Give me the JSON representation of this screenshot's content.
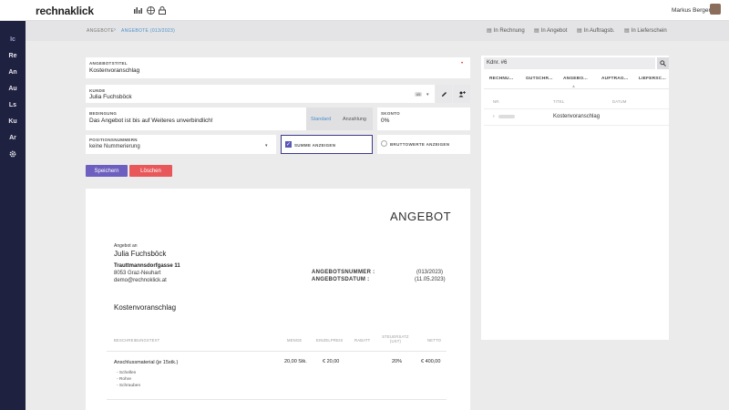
{
  "app": {
    "logo": "rechnaklick",
    "user": "Markus Berger"
  },
  "topbar_icons": [
    "chart-icon",
    "globe-icon",
    "lock-icon"
  ],
  "sidebar": {
    "items": [
      "Ic",
      "Re",
      "An",
      "Au",
      "Ls",
      "Ku",
      "Ar"
    ]
  },
  "breadcrumb": {
    "parent": "ANGEBOTE",
    "current": "ANGEBOTE (013/2023)"
  },
  "subactions": [
    "In Rechnung",
    "In Angebot",
    "In Auftragsb.",
    "In Lieferschein"
  ],
  "form": {
    "title_label": "ANGEBOTSTITEL",
    "title_value": "Kostenvoranschlag",
    "customer_label": "KUNDE",
    "customer_value": "Julia Fuchsböck",
    "customer_badge": "#5",
    "condition_label": "BEDINGUNG",
    "condition_value": "Das Angebot ist bis auf Weiteres unverbindlich!",
    "standard_label": "Standard",
    "anzahlung_label": "Anzahlung",
    "skonto_label": "SKONTO",
    "skonto_value": "0%",
    "positions_label": "POSITIONSNUMMERN",
    "positions_value": "keine Nummerierung",
    "sum_label": "SUMME ANZEIGEN",
    "brutto_label": "BRUTTOWERTE ANZEIGEN",
    "save": "Speichern",
    "delete": "Löschen"
  },
  "right": {
    "search_value": "Kdnr. #6",
    "tabs": [
      "RECHNU...",
      "GUTSCHR...",
      "ANGEBO...",
      "AUFTRAG...",
      "LIEFERSC..."
    ],
    "headers": [
      "NR.",
      "TITEL",
      "DATUM"
    ],
    "row": {
      "nr": "",
      "title": "Kostenvoranschlag",
      "date": ""
    }
  },
  "doc": {
    "heading": "ANGEBOT",
    "to_label": "Angebot an",
    "name": "Julia Fuchsböck",
    "street": "Trauttmannsdorfgasse 11",
    "city": "8053 Graz-Neuhart",
    "email": "demo@rechnoklick.at",
    "nr_label": "ANGEBOTSNUMMER :",
    "date_label": "ANGEBOTSDATUM :",
    "nr_value": "(013/2023)",
    "date_value": "(11.05.2023)",
    "subject": "Kostenvoranschlag",
    "table_headers": [
      "BESCHREIBUNGSTEXT",
      "MENGE",
      "EINZELPREIS",
      "RABATT",
      "STEUERSATZ (UST)",
      "NETTO"
    ],
    "row1": {
      "desc": "Anschlussmaterial (je 15stk.)",
      "sub": [
        "- Schellen",
        "- Rohre",
        "- Schrauben"
      ],
      "qty": "20,00 Stk.",
      "price": "€ 20,00",
      "discount": "",
      "tax": "20%",
      "net": "€ 400,00"
    }
  }
}
